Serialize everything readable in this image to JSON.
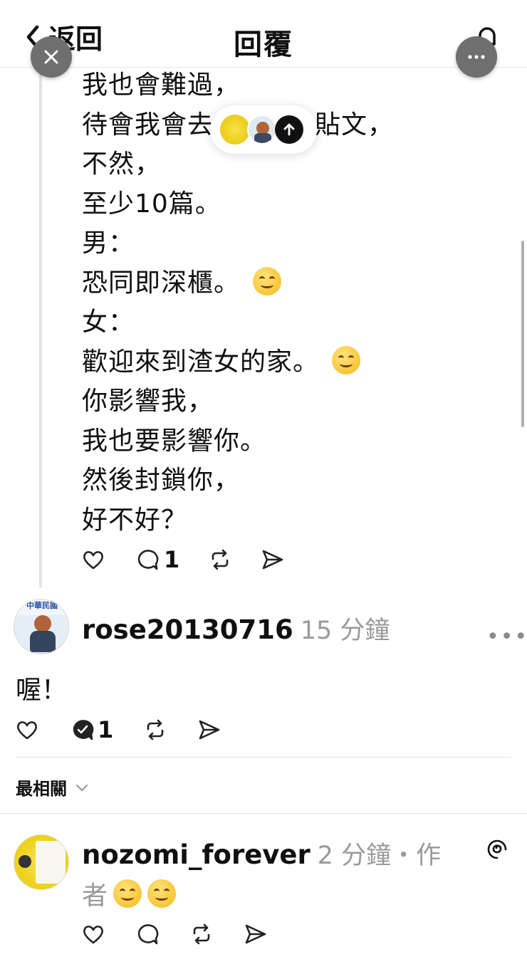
{
  "header": {
    "back_label": "返回",
    "title": "回覆"
  },
  "post": {
    "lines": [
      "我也會難過，",
      "待會我會去",
      "不然，",
      "至少10篇。",
      "男：",
      "恐同即深櫃。",
      "女：",
      "歡迎來到渣女的家。",
      "你影響我，",
      "我也要影響你。",
      "然後封鎖你，",
      "好不好？"
    ],
    "line2_tail": "貼文，",
    "reply_count": "1"
  },
  "comment": {
    "username": "rose20130716",
    "time": "15 分鐘",
    "text": "喔！",
    "reply_count": "1"
  },
  "sort": {
    "label": "最相關"
  },
  "reply2": {
    "username": "nozomi_forever",
    "time": "2 分鐘・作",
    "wrap_text": "者"
  },
  "colors": {
    "text": "#101010",
    "muted": "#9a9a9a",
    "fab": "#6f6f6f",
    "emoji": "#f7b91b"
  },
  "icons": [
    "chevron-left-icon",
    "bell-icon",
    "close-icon",
    "more-icon",
    "arrow-up-icon",
    "heart-icon",
    "comment-icon",
    "repost-icon",
    "share-icon",
    "chevron-down-icon",
    "threads-icon"
  ]
}
